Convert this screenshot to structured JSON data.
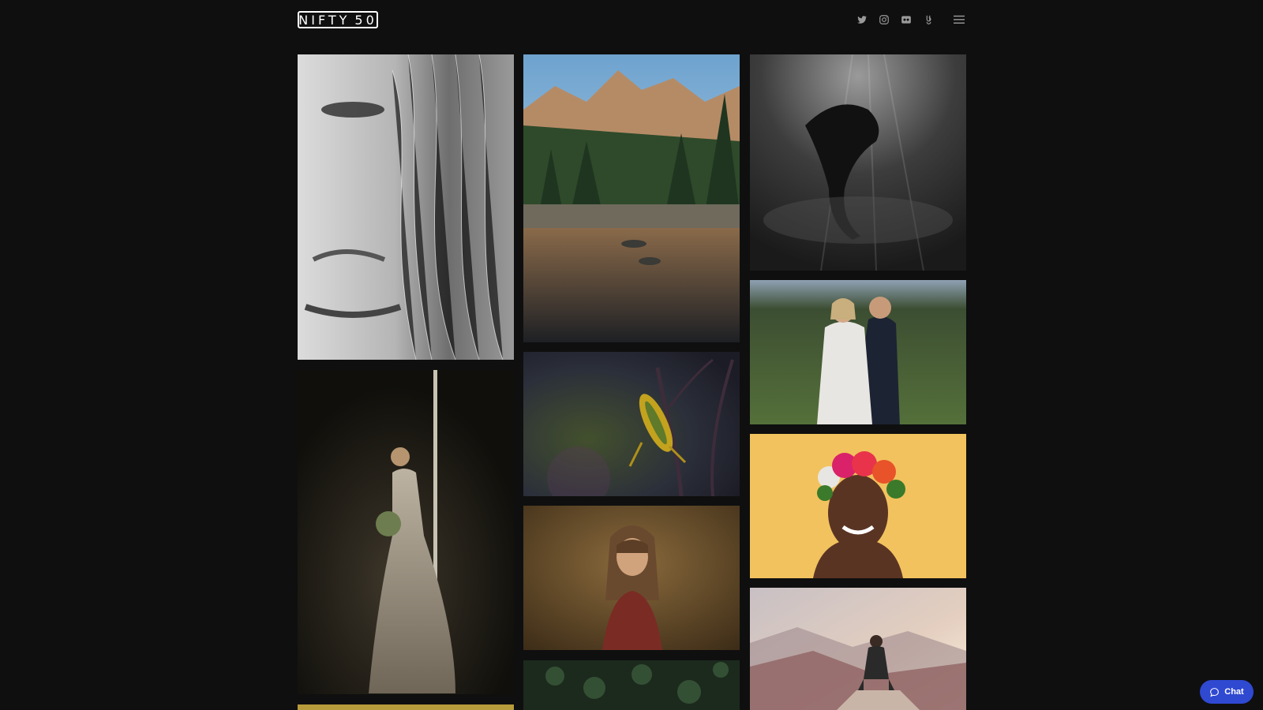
{
  "header": {
    "logo_left": "NIFTY",
    "logo_right": "50",
    "social": [
      {
        "icon": "twitter-icon"
      },
      {
        "icon": "instagram-icon"
      },
      {
        "icon": "flickr-icon"
      },
      {
        "icon": "500px-icon"
      }
    ],
    "menu_icon": "hamburger-menu-icon"
  },
  "gallery": {
    "photos": [
      {
        "subject": "bw-freckled-woman-portrait"
      },
      {
        "subject": "bride-in-window-light"
      },
      {
        "subject": "yellow-photo-partial"
      },
      {
        "subject": "mountain-lake-reflection"
      },
      {
        "subject": "grasshopper-on-branch"
      },
      {
        "subject": "girl-with-bangs-in-field"
      },
      {
        "subject": "dark-foliage"
      },
      {
        "subject": "underwater-swimmer-bw"
      },
      {
        "subject": "wedding-couple-meadow"
      },
      {
        "subject": "woman-with-flower-crown"
      },
      {
        "subject": "woman-on-mountain-summit"
      }
    ]
  },
  "chat": {
    "label": "Chat"
  },
  "colors": {
    "background": "#0f0f0f",
    "chat_button": "#2f49d1",
    "icon": "#9a9a9a"
  }
}
